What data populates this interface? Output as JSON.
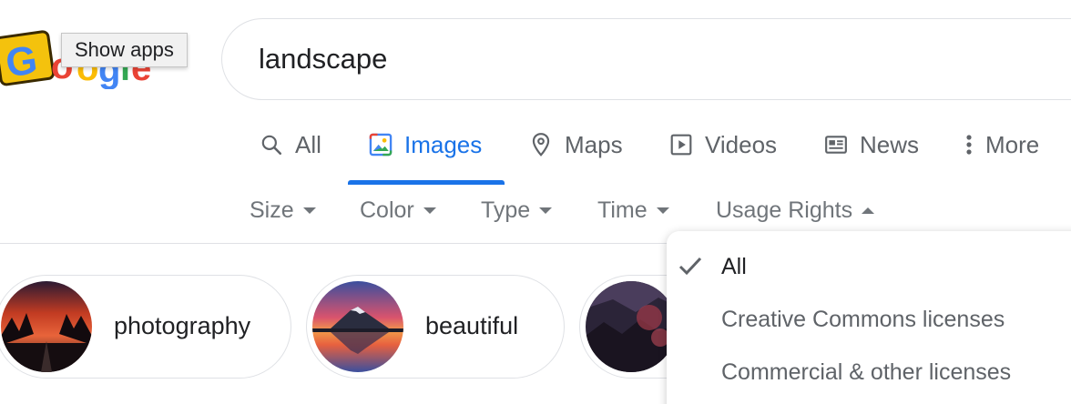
{
  "logo": {
    "alt": "Google"
  },
  "tooltip": {
    "text": "Show apps"
  },
  "search": {
    "query": "landscape"
  },
  "tabs": [
    {
      "label": "All",
      "icon": "search-icon",
      "active": false
    },
    {
      "label": "Images",
      "icon": "image-icon",
      "active": true
    },
    {
      "label": "Maps",
      "icon": "map-pin-icon",
      "active": false
    },
    {
      "label": "Videos",
      "icon": "play-icon",
      "active": false
    },
    {
      "label": "News",
      "icon": "newspaper-icon",
      "active": false
    },
    {
      "label": "More",
      "icon": "more-vert-icon",
      "active": false
    }
  ],
  "filters": [
    {
      "label": "Size",
      "open": false
    },
    {
      "label": "Color",
      "open": false
    },
    {
      "label": "Type",
      "open": false
    },
    {
      "label": "Time",
      "open": false
    },
    {
      "label": "Usage Rights",
      "open": true
    }
  ],
  "chips": [
    {
      "label": "photography"
    },
    {
      "label": "beautiful"
    },
    {
      "label": ""
    }
  ],
  "usage_rights_menu": {
    "items": [
      {
        "label": "All",
        "selected": true
      },
      {
        "label": "Creative Commons licenses",
        "selected": false
      },
      {
        "label": "Commercial & other licenses",
        "selected": false
      }
    ]
  },
  "colors": {
    "accent": "#1a73e8",
    "tab_text": "#5f6368",
    "filter_text": "#70757a",
    "border": "#dfe1e5"
  }
}
